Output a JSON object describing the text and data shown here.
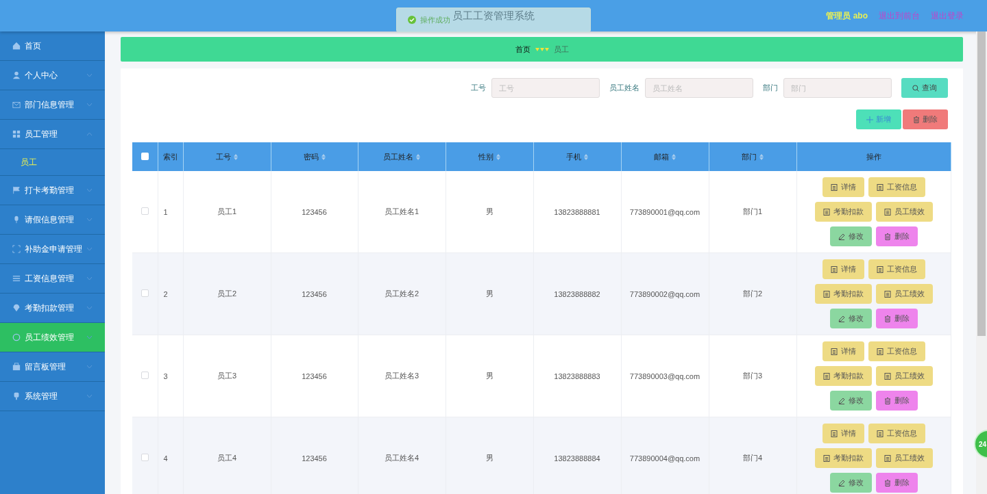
{
  "header": {
    "title": "员工工资管理系统",
    "user": "管理员 abo",
    "links": [
      "退出到前台",
      "退出登录"
    ]
  },
  "toast": {
    "message": "操作成功"
  },
  "sidebar": {
    "items": [
      {
        "label": "首页",
        "selected": false
      },
      {
        "label": "个人中心",
        "selected": false,
        "expanded": false
      },
      {
        "label": "部门信息管理",
        "selected": false,
        "expanded": false
      },
      {
        "label": "员工管理",
        "selected": false,
        "expanded": true,
        "children": [
          {
            "label": "员工",
            "selected": true
          }
        ]
      },
      {
        "label": "打卡考勤管理",
        "selected": false,
        "expanded": false
      },
      {
        "label": "请假信息管理",
        "selected": false,
        "expanded": false
      },
      {
        "label": "补助金申请管理",
        "selected": false,
        "expanded": false
      },
      {
        "label": "工资信息管理",
        "selected": false,
        "expanded": false
      },
      {
        "label": "考勤扣款管理",
        "selected": false,
        "expanded": false
      },
      {
        "label": "员工绩效管理",
        "selected": true,
        "expanded": false
      },
      {
        "label": "留言板管理",
        "selected": false,
        "expanded": false
      },
      {
        "label": "系统管理",
        "selected": false,
        "expanded": false
      }
    ]
  },
  "breadcrumb": [
    "首页",
    "员工"
  ],
  "search": {
    "fields": [
      {
        "label": "工号",
        "placeholder": "工号"
      },
      {
        "label": "员工姓名",
        "placeholder": "员工姓名"
      },
      {
        "label": "部门",
        "placeholder": "部门"
      }
    ],
    "button": "查询"
  },
  "toolbar": [
    {
      "label": "新增",
      "kind": "add"
    },
    {
      "label": "删除",
      "kind": "delete"
    }
  ],
  "table": {
    "select_all": false,
    "columns": [
      {
        "label": "索引",
        "sortable": false
      },
      {
        "label": "工号",
        "sortable": true
      },
      {
        "label": "密码",
        "sortable": true
      },
      {
        "label": "员工姓名",
        "sortable": true
      },
      {
        "label": "性别",
        "sortable": true
      },
      {
        "label": "手机",
        "sortable": true
      },
      {
        "label": "邮箱",
        "sortable": true
      },
      {
        "label": "部门",
        "sortable": true
      },
      {
        "label": "操作",
        "sortable": false
      }
    ],
    "rows": [
      {
        "checked": false,
        "cells": [
          "1",
          "员工1",
          "123456",
          "员工姓名1",
          "男",
          "13823888881",
          "773890001@qq.com",
          "部门1"
        ],
        "actions": [
          {
            "label": "详情",
            "kind": "info"
          },
          {
            "label": "工资信息",
            "kind": "info"
          },
          {
            "label": "考勤扣款",
            "kind": "info"
          },
          {
            "label": "员工绩效",
            "kind": "info"
          },
          {
            "label": "修改",
            "kind": "edit"
          },
          {
            "label": "删除",
            "kind": "delete"
          }
        ]
      },
      {
        "checked": false,
        "cells": [
          "2",
          "员工2",
          "123456",
          "员工姓名2",
          "男",
          "13823888882",
          "773890002@qq.com",
          "部门2"
        ],
        "actions": [
          {
            "label": "详情",
            "kind": "info"
          },
          {
            "label": "工资信息",
            "kind": "info"
          },
          {
            "label": "考勤扣款",
            "kind": "info"
          },
          {
            "label": "员工绩效",
            "kind": "info"
          },
          {
            "label": "修改",
            "kind": "edit"
          },
          {
            "label": "删除",
            "kind": "delete"
          }
        ]
      },
      {
        "checked": false,
        "cells": [
          "3",
          "员工3",
          "123456",
          "员工姓名3",
          "男",
          "13823888883",
          "773890003@qq.com",
          "部门3"
        ],
        "actions": [
          {
            "label": "详情",
            "kind": "info"
          },
          {
            "label": "工资信息",
            "kind": "info"
          },
          {
            "label": "考勤扣款",
            "kind": "info"
          },
          {
            "label": "员工绩效",
            "kind": "info"
          },
          {
            "label": "修改",
            "kind": "edit"
          },
          {
            "label": "删除",
            "kind": "delete"
          }
        ]
      },
      {
        "checked": false,
        "cells": [
          "4",
          "员工4",
          "123456",
          "员工姓名4",
          "男",
          "13823888884",
          "773890004@qq.com",
          "部门4"
        ],
        "actions": [
          {
            "label": "详情",
            "kind": "info"
          },
          {
            "label": "工资信息",
            "kind": "info"
          },
          {
            "label": "考勤扣款",
            "kind": "info"
          },
          {
            "label": "员工绩效",
            "kind": "info"
          },
          {
            "label": "修改",
            "kind": "edit"
          },
          {
            "label": "删除",
            "kind": "delete"
          }
        ]
      }
    ]
  },
  "float_badge": "24"
}
